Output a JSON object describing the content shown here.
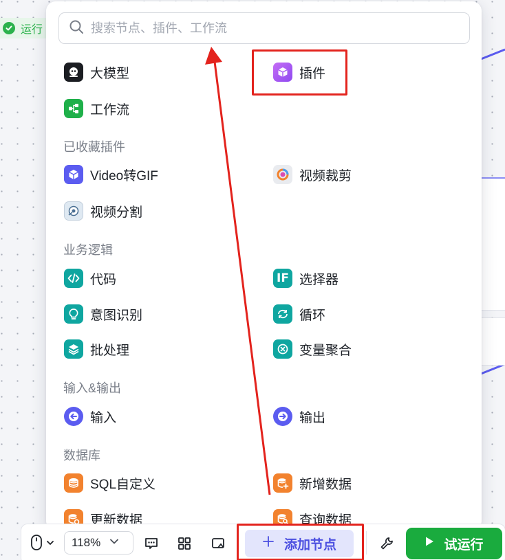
{
  "status": {
    "label": "运行"
  },
  "search": {
    "placeholder": "搜索节点、插件、工作流"
  },
  "primary_nodes": [
    {
      "label": "大模型",
      "icon": "llm-icon"
    },
    {
      "label": "插件",
      "icon": "plugin-cube-icon"
    },
    {
      "label": "工作流",
      "icon": "workflow-icon"
    }
  ],
  "sections": [
    {
      "title": "已收藏插件",
      "items": [
        "Video转GIF",
        "视频裁剪",
        "视频分割"
      ]
    },
    {
      "title": "业务逻辑",
      "items": [
        "代码",
        "选择器",
        "意图识别",
        "循环",
        "批处理",
        "变量聚合"
      ]
    },
    {
      "title": "输入&输出",
      "items": [
        "输入",
        "输出"
      ]
    },
    {
      "title": "数据库",
      "items": [
        "SQL自定义",
        "新增数据",
        "更新数据",
        "查询数据"
      ]
    }
  ],
  "selector_icon_text": "IF",
  "toolbar": {
    "zoom": "118%",
    "add_node_label": "添加节点",
    "run_label": "试运行"
  },
  "colors": {
    "accent": "#4b4fe0",
    "run_green": "#1aab3e",
    "annotation_red": "#e3231d",
    "teal": "#0fa6a0",
    "orange": "#f2822e",
    "indigo": "#5b5cf0"
  }
}
